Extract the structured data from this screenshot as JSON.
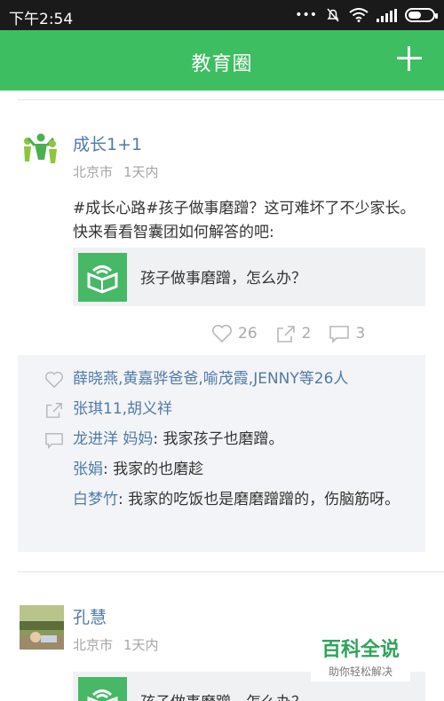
{
  "status": {
    "time": "下午2:54"
  },
  "header": {
    "title": "教育圈"
  },
  "posts": [
    {
      "name": "成长1+1",
      "location": "北京市",
      "time": "1天内",
      "text": "#成长心路#孩子做事磨蹭？这可难坏了不少家长。快来看看智囊团如何解答的吧:",
      "share_title": "孩子做事磨蹭，怎么办？",
      "likes": "26",
      "shares": "2",
      "comments": "3"
    },
    {
      "name": "孔慧",
      "location": "北京市",
      "time": "1天内",
      "share_title": "孩子做事磨蹭，怎么办？"
    }
  ],
  "interactions": {
    "likers": "薛晓燕,黄嘉骅爸爸,喻茂霞,JENNY等26人",
    "sharers": "张琪11,胡义祥",
    "comments": [
      {
        "user": "龙进洋 妈妈",
        "text": ": 我家孩子也磨蹭。"
      },
      {
        "user": "张娟",
        "text": ": 我家的也磨趁"
      },
      {
        "user": "白梦竹",
        "text": ": 我家的吃饭也是磨磨蹭蹭的，伤脑筋呀。"
      }
    ]
  },
  "watermark": {
    "title": "百科全说",
    "subtitle": "助你轻松解决"
  },
  "colors": {
    "appbar": "#3dbe61",
    "link": "#4f7ba6",
    "muted": "#a6a6a6"
  }
}
